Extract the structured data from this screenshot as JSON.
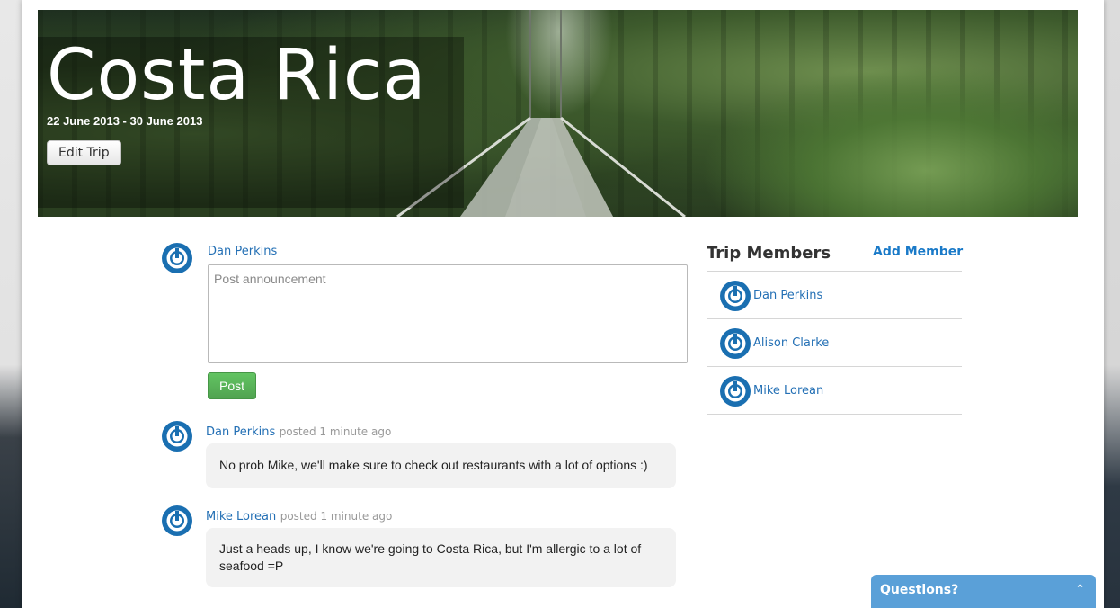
{
  "trip": {
    "title": "Costa Rica",
    "dates": "22 June 2013 - 30 June 2013",
    "edit_label": "Edit Trip"
  },
  "composer": {
    "author": "Dan Perkins",
    "placeholder": "Post announcement",
    "post_label": "Post"
  },
  "posts": [
    {
      "author": "Dan Perkins",
      "meta": "posted 1 minute ago",
      "body": "No prob Mike, we'll make sure to check out restaurants with a lot of options :)"
    },
    {
      "author": "Mike Lorean",
      "meta": "posted 1 minute ago",
      "body": "Just a heads up, I know we're going to Costa Rica, but I'm allergic to a lot of seafood =P"
    }
  ],
  "members": {
    "title": "Trip Members",
    "add_label": "Add Member",
    "items": [
      {
        "name": "Dan Perkins"
      },
      {
        "name": "Alison Clarke"
      },
      {
        "name": "Mike Lorean"
      }
    ]
  },
  "help": {
    "label": "Questions?",
    "icon": "chevron-up-icon"
  },
  "colors": {
    "accent": "#2470b5",
    "avatar": "#1a6fb1",
    "post_button": "#5bb75b",
    "help_bar": "#5aa0d8"
  }
}
